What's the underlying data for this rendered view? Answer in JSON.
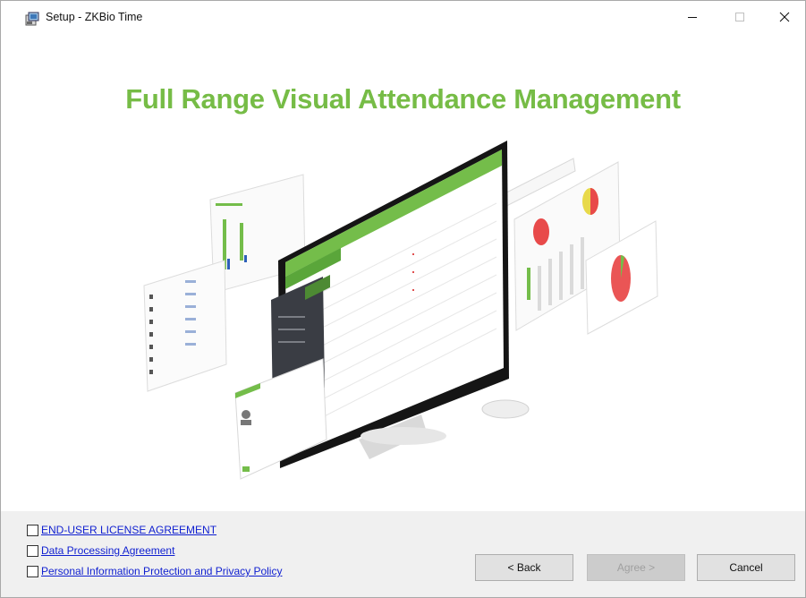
{
  "window": {
    "title": "Setup - ZKBio Time",
    "controls": {
      "minimize": "minimize-icon",
      "maximize": "maximize-icon",
      "close": "close-icon"
    }
  },
  "banner": {
    "headline": "Full Range Visual Attendance Management",
    "image": "computer-monitor-dashboard-illustration"
  },
  "agreements": [
    {
      "label": "END-USER LICENSE AGREEMENT",
      "checked": false
    },
    {
      "label": "Data Processing Agreement",
      "checked": false
    },
    {
      "label": "Personal Information Protection and Privacy Policy",
      "checked": false
    }
  ],
  "buttons": {
    "back": "< Back",
    "agree": "Agree >",
    "cancel": "Cancel"
  },
  "colors": {
    "accent_green": "#76bc46",
    "link_blue": "#0f1fd0",
    "footer_bg": "#f0f0f0"
  }
}
